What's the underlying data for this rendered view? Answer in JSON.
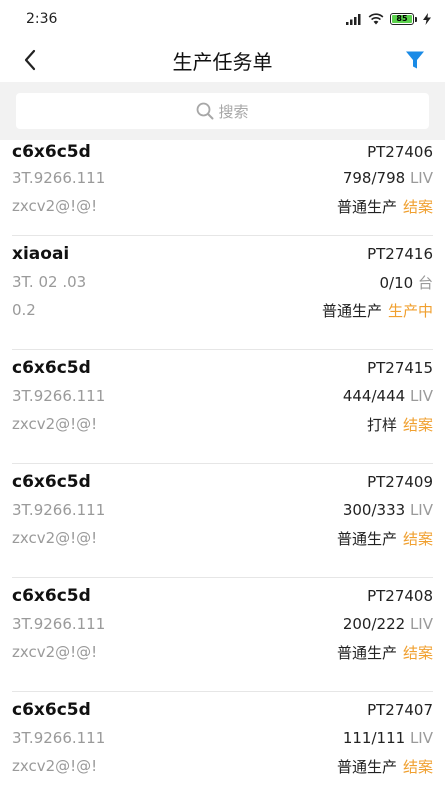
{
  "status_bar": {
    "time": "2:36",
    "battery": "85"
  },
  "header": {
    "title": "生产任务单"
  },
  "search": {
    "placeholder": "搜索"
  },
  "colors": {
    "accent_blue": "#1a8be6",
    "status_orange": "#f0a030"
  },
  "orders": [
    {
      "name": "c6x6c5d",
      "no": "PT27406",
      "spec": "3T.9266.111",
      "qty": "798/798",
      "unit": "LIV",
      "code": "zxcv2@!@!",
      "type": "普通生产",
      "status": "结案"
    },
    {
      "name": "xiaoai",
      "no": "PT27416",
      "spec": "3T. 02 .03",
      "qty": "0/10",
      "unit": "台",
      "code": "0.2",
      "type": "普通生产",
      "status": "生产中"
    },
    {
      "name": "c6x6c5d",
      "no": "PT27415",
      "spec": "3T.9266.111",
      "qty": "444/444",
      "unit": "LIV",
      "code": "zxcv2@!@!",
      "type": "打样",
      "status": "结案"
    },
    {
      "name": "c6x6c5d",
      "no": "PT27409",
      "spec": "3T.9266.111",
      "qty": "300/333",
      "unit": "LIV",
      "code": "zxcv2@!@!",
      "type": "普通生产",
      "status": "结案"
    },
    {
      "name": "c6x6c5d",
      "no": "PT27408",
      "spec": "3T.9266.111",
      "qty": "200/222",
      "unit": "LIV",
      "code": "zxcv2@!@!",
      "type": "普通生产",
      "status": "结案"
    },
    {
      "name": "c6x6c5d",
      "no": "PT27407",
      "spec": "3T.9266.111",
      "qty": "111/111",
      "unit": "LIV",
      "code": "zxcv2@!@!",
      "type": "普通生产",
      "status": "结案"
    }
  ]
}
